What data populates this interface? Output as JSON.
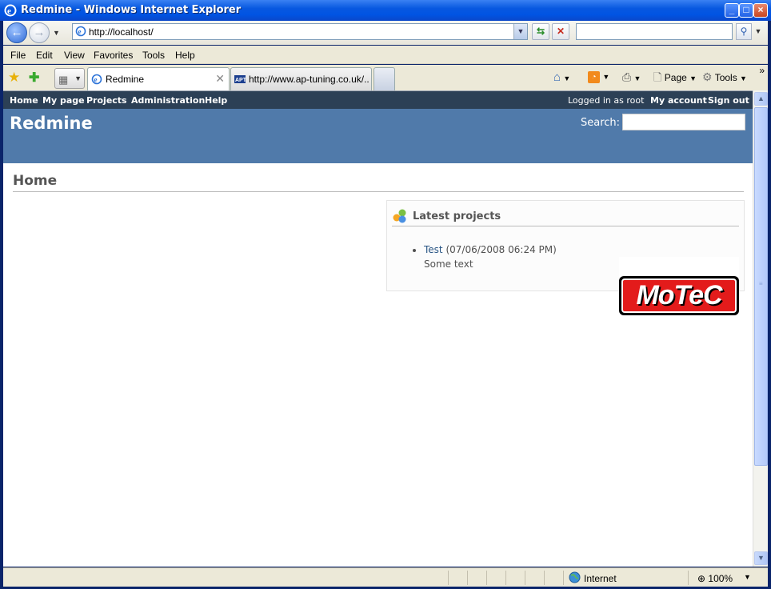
{
  "window": {
    "title": "Redmine - Windows Internet Explorer"
  },
  "addressbar": {
    "url": "http://localhost/",
    "search_value": ""
  },
  "menubar": {
    "items": [
      "File",
      "Edit",
      "View",
      "Favorites",
      "Tools",
      "Help"
    ]
  },
  "tabs": [
    {
      "label": "Redmine",
      "active": true
    },
    {
      "label": "http://www.ap-tuning.co.uk/...",
      "active": false
    }
  ],
  "commandbar": {
    "page_label": "Page",
    "tools_label": "Tools",
    "more": "»"
  },
  "redmine": {
    "top_menu": [
      "Home",
      "My page",
      "Projects",
      "Administration",
      "Help"
    ],
    "logged_in_text": "Logged in as root",
    "my_account": "My account",
    "sign_out": "Sign out",
    "app_title": "Redmine",
    "search_label": "Search:",
    "search_value": "",
    "page_title": "Home",
    "latest_projects": {
      "title": "Latest projects",
      "items": [
        {
          "name": "Test",
          "date": "(07/06/2008 06:24 PM)",
          "description": "Some text"
        }
      ]
    },
    "logo_text": "MoTeC"
  },
  "statusbar": {
    "zone": "Internet",
    "zoom": "100%"
  },
  "colors": {
    "redmine_top": "#2c4056",
    "redmine_header": "#507aaa",
    "link": "#2a5685"
  }
}
